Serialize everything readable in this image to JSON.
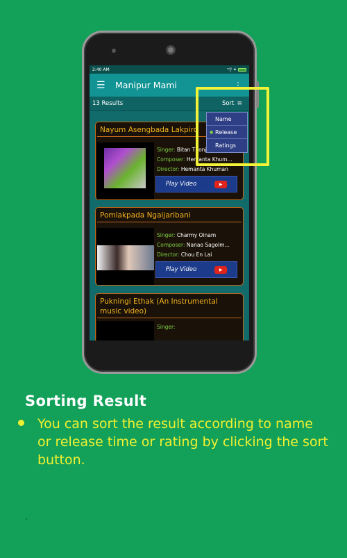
{
  "status_bar": {
    "time": "2:40 AM",
    "signal_text": "ᵐ|ˡ ✦"
  },
  "app_bar": {
    "title": "Manipur Mami",
    "menu_icon": "hamburger-icon",
    "overflow_icon": "more-vert-icon"
  },
  "results_bar": {
    "count_text": "13 Results",
    "sort_label": "Sort",
    "sort_icon": "sort-icon"
  },
  "sort_menu": {
    "items": [
      {
        "label": "Name",
        "checked": false
      },
      {
        "label": "Release",
        "checked": true
      },
      {
        "label": "Ratings",
        "checked": false
      }
    ]
  },
  "cards": [
    {
      "title": "Nayum Asengbada Lakpiro",
      "singer_label": "Singer:",
      "singer": "Bitan Thonj",
      "composer_label": "Composer:",
      "composer": "Hemanta Khum...",
      "director_label": "Director:",
      "director": "Hemanta Khuman",
      "play_label": "Play Video"
    },
    {
      "title": "Pomlakpada Ngaijaribani",
      "singer_label": "Singer:",
      "singer": "Charmy Oinam",
      "composer_label": "Composer:",
      "composer": "Nanao Sagolm...",
      "director_label": "Director:",
      "director": "Chou En Lai",
      "play_label": "Play Video"
    },
    {
      "title": "Pukningi Ethak (An Instrumental music video)",
      "singer_label": "Singer:",
      "singer": ""
    }
  ],
  "caption": {
    "heading": "Sorting Result",
    "bullet": "You can sort the result according to name or release time or rating by clicking the sort button."
  },
  "colors": {
    "background": "#13a15a",
    "app_bar": "#129494",
    "card_title": "#f2b21c",
    "meta_key": "#7fcf45",
    "play_button": "#1c3b8a",
    "highlight": "#f2f238",
    "caption_text": "#f0f030"
  }
}
